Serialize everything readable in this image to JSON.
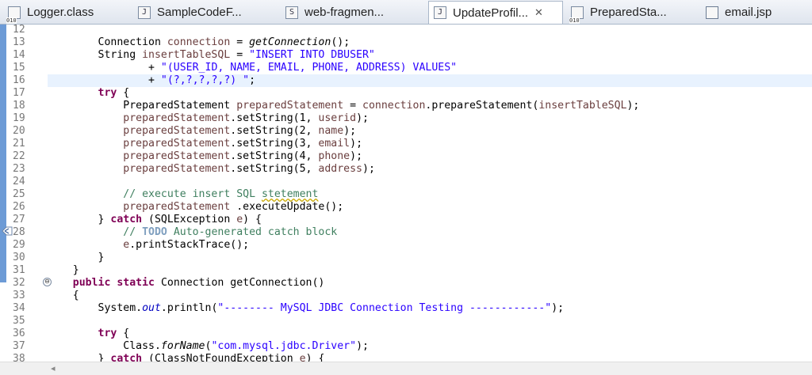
{
  "tabs": [
    {
      "label": "Logger.class",
      "icon": "class-file-icon"
    },
    {
      "label": "SampleCodeF...",
      "icon": "java-file-icon"
    },
    {
      "label": "web-fragmen...",
      "icon": "xml-file-icon"
    },
    {
      "label": "UpdateProfil...",
      "icon": "java-file-icon",
      "active": true,
      "close": "✕"
    },
    {
      "label": "PreparedSta...",
      "icon": "class-file-icon"
    },
    {
      "label": "email.jsp",
      "icon": "jsp-file-icon"
    }
  ],
  "line_numbers": [
    "12",
    "13",
    "14",
    "15",
    "16",
    "17",
    "18",
    "19",
    "20",
    "21",
    "22",
    "23",
    "24",
    "25",
    "26",
    "27",
    "28",
    "29",
    "30",
    "31",
    "32",
    "33",
    "34",
    "35",
    "36",
    "37",
    "38"
  ],
  "code": {
    "l13": [
      "        Connection ",
      "connection",
      " = ",
      "getConnection",
      "();"
    ],
    "l14": [
      "        String ",
      "insertTableSQL",
      " = ",
      "\"INSERT INTO DBUSER\""
    ],
    "l15": [
      "                + ",
      "\"(USER_ID, NAME, EMAIL, PHONE, ADDRESS) VALUES\""
    ],
    "l16": [
      "                + ",
      "\"(?,?,?,?,?) \"",
      ";"
    ],
    "l17": [
      "        ",
      "try",
      " {"
    ],
    "l18": [
      "            PreparedStatement ",
      "preparedStatement",
      " = ",
      "connection",
      ".prepareStatement(",
      "insertTableSQL",
      ");"
    ],
    "l19": [
      "            ",
      "preparedStatement",
      ".setString(1, ",
      "userid",
      ");"
    ],
    "l20": [
      "            ",
      "preparedStatement",
      ".setString(2, ",
      "name",
      ");"
    ],
    "l21": [
      "            ",
      "preparedStatement",
      ".setString(3, ",
      "email",
      ");"
    ],
    "l22": [
      "            ",
      "preparedStatement",
      ".setString(4, ",
      "phone",
      ");"
    ],
    "l23": [
      "            ",
      "preparedStatement",
      ".setString(5, ",
      "address",
      ");"
    ],
    "l25": [
      "            ",
      "// execute insert SQL ",
      "stetement"
    ],
    "l26": [
      "            ",
      "preparedStatement",
      " .executeUpdate();"
    ],
    "l27": [
      "        } ",
      "catch",
      " (SQLException ",
      "e",
      ") {"
    ],
    "l28": [
      "            ",
      "// ",
      "TODO",
      " Auto-generated catch block"
    ],
    "l29": [
      "            ",
      "e",
      ".printStackTrace();"
    ],
    "l30": [
      "        }"
    ],
    "l31": [
      "    }"
    ],
    "l32": [
      "    ",
      "public",
      " ",
      "static",
      " Connection getConnection()"
    ],
    "l33": [
      "    {"
    ],
    "l34": [
      "        System.",
      "out",
      ".println(",
      "\"-------- MySQL JDBC Connection Testing ------------\"",
      ");"
    ],
    "l36": [
      "        ",
      "try",
      " {"
    ],
    "l37": [
      "            Class.",
      "forName",
      "(",
      "\"com.mysql.jdbc.Driver\"",
      ");"
    ],
    "l38": [
      "        } ",
      "catch",
      " (ClassNotFoundException ",
      "e",
      ") {"
    ]
  },
  "collapse_glyph": "⊖",
  "scroll_left_glyph": "◂",
  "colors": {
    "keyword": "#7f0055",
    "string": "#2a00ff",
    "field": "#0000c0",
    "local_var": "#6a3e3e",
    "comment": "#3f7f5f",
    "current_line": "#e8f2fe"
  }
}
